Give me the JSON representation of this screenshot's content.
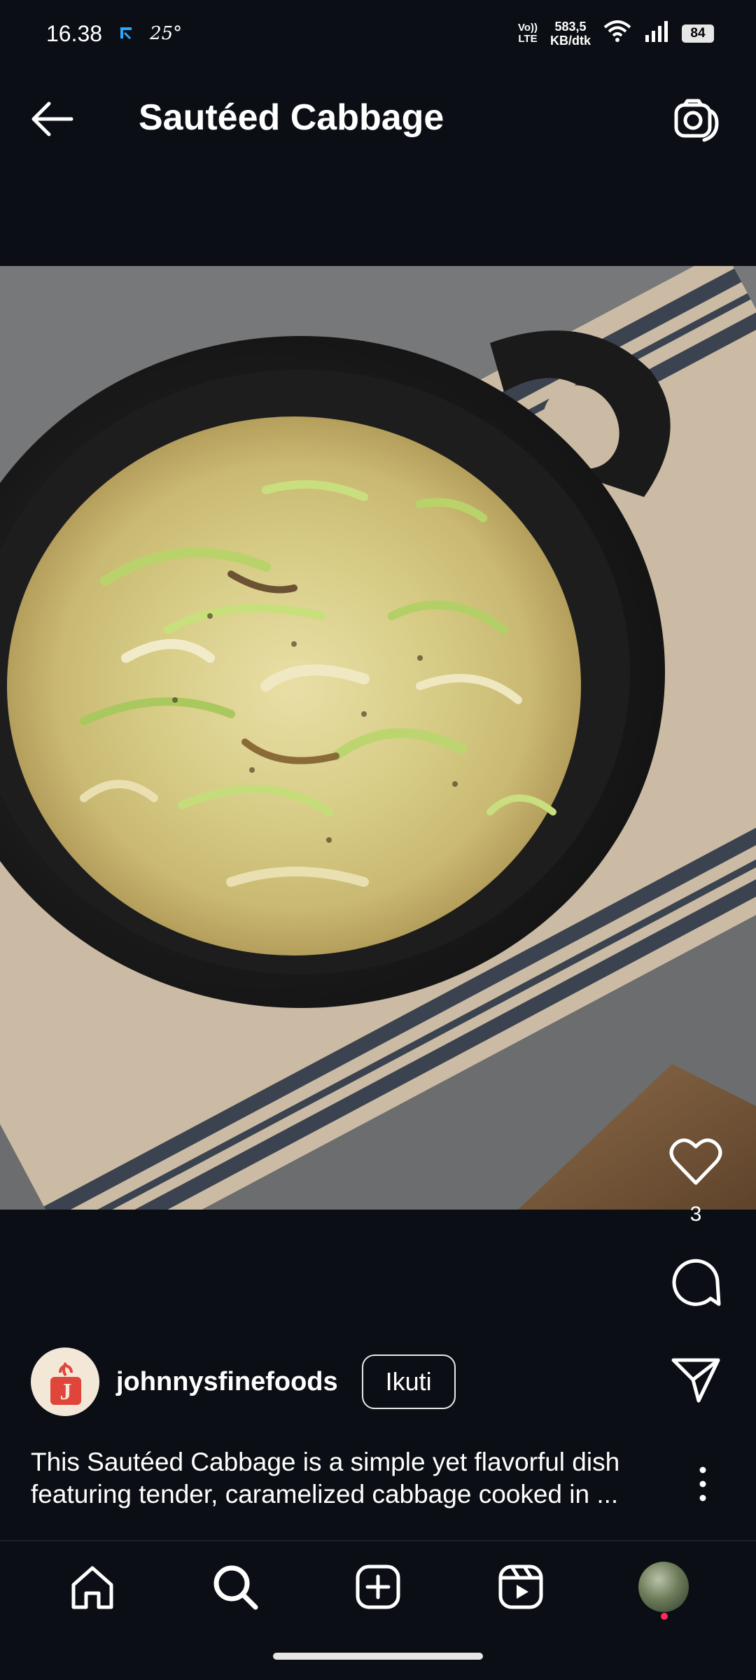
{
  "status_bar": {
    "time": "16.38",
    "temperature": "25°",
    "volte": "VoLTE",
    "net_speed_value": "583,5",
    "net_speed_unit": "KB/dtk",
    "battery": "84"
  },
  "header": {
    "title": "Sautéed Cabbage",
    "back_icon": "arrow-left-icon",
    "camera_icon": "camera-icon"
  },
  "post": {
    "image_alt": "Sautéed cabbage in a cast-iron skillet on a striped towel",
    "likes_count": "3",
    "author": {
      "username": "johnnysfinefoods",
      "logo_letter": "J"
    },
    "follow_label": "Ikuti",
    "caption_line1": "This Sautéed Cabbage is a simple yet flavorful dish",
    "caption_line2": "featuring tender, caramelized cabbage cooked in ..."
  },
  "actions": {
    "like_icon": "heart-icon",
    "comment_icon": "comment-icon",
    "share_icon": "send-icon",
    "more_icon": "more-vertical-icon"
  },
  "bottom_nav": {
    "items": [
      "home-icon",
      "search-icon",
      "create-icon",
      "reels-icon",
      "profile-avatar"
    ]
  },
  "colors": {
    "background": "#0b0f15",
    "text": "#ffffff",
    "notification_dot": "#ff2d55",
    "logo_red": "#e0453a"
  }
}
